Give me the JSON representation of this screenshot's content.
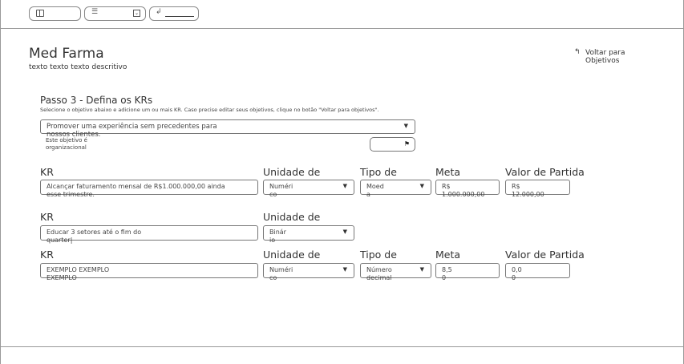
{
  "toolbar": {
    "layout_icon": "layout-icon",
    "list_icon": "list-icon",
    "dropdown_icon": "dropdown-icon",
    "link_icon": "return-icon"
  },
  "header": {
    "title": "Med Farma",
    "subtitle": "texto texto texto descritivo",
    "back_label": "Voltar para Objetivos"
  },
  "step": {
    "title": "Passo 3 - Defina os KRs",
    "description": "Selecione o objetivo abaixo e adicione um ou mais KR. Caso precise editar seus objetivos, clique no botão \"Voltar para objetivos\".",
    "objective": "Promover uma experiência sem precedentes para nossos clientes.",
    "org_label": "Este objetivo é organizacional"
  },
  "labels": {
    "kr": "KR",
    "unit": "Unidade de",
    "type": "Tipo de",
    "goal": "Meta",
    "start": "Valor de Partida"
  },
  "krs": [
    {
      "text": "Alcançar faturamento mensal de R$1.000.000,00 ainda esse trimestre.",
      "unit": "Numérico",
      "type": "Moeda",
      "goal": "R$ 1.000.000,00",
      "start": "R$ 12.000,00"
    },
    {
      "text": "Educar 3 setores até o fim do quarter|",
      "unit": "Binário"
    },
    {
      "text": "EXEMPLO EXEMPLO EXEMPLO",
      "unit": "Numérico",
      "type": "Número decimal",
      "goal": "8,50",
      "start": "0,00"
    }
  ]
}
